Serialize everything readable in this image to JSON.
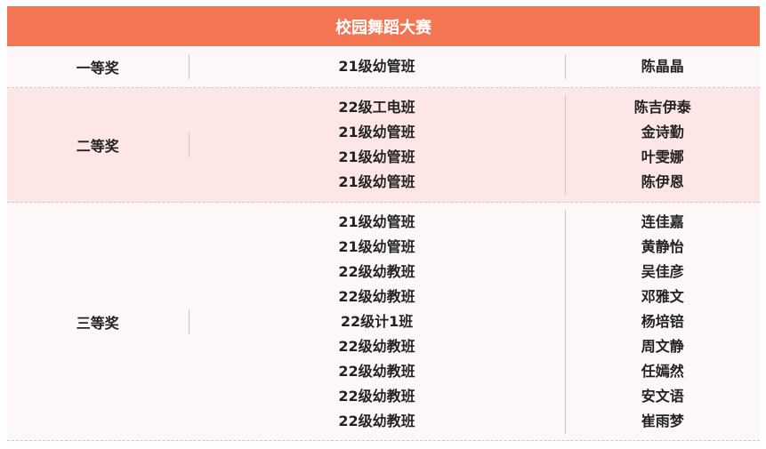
{
  "title": "校园舞蹈大赛",
  "colors": {
    "header": "#f27653",
    "row_light": "#fdf8f7",
    "row_pink": "#fde6e6"
  },
  "awards": [
    {
      "prize": "一等奖",
      "classes": [
        "21级幼管班"
      ],
      "names": [
        "陈晶晶"
      ]
    },
    {
      "prize": "二等奖",
      "classes": [
        "22级工电班",
        "21级幼管班",
        "21级幼管班",
        "21级幼管班"
      ],
      "names": [
        "陈吉伊泰",
        "金诗勤",
        "叶雯娜",
        "陈伊恩"
      ]
    },
    {
      "prize": "三等奖",
      "classes": [
        "21级幼管班",
        "21级幼管班",
        "22级幼教班",
        "22级幼教班",
        "22级计1班",
        "22级幼教班",
        "22级幼教班",
        "22级幼教班",
        "22级幼教班"
      ],
      "names": [
        "连佳嘉",
        "黄静怡",
        "吴佳彦",
        "邓雅文",
        "杨培锫",
        "周文静",
        "任嫣然",
        "安文语",
        "崔雨梦"
      ]
    }
  ]
}
